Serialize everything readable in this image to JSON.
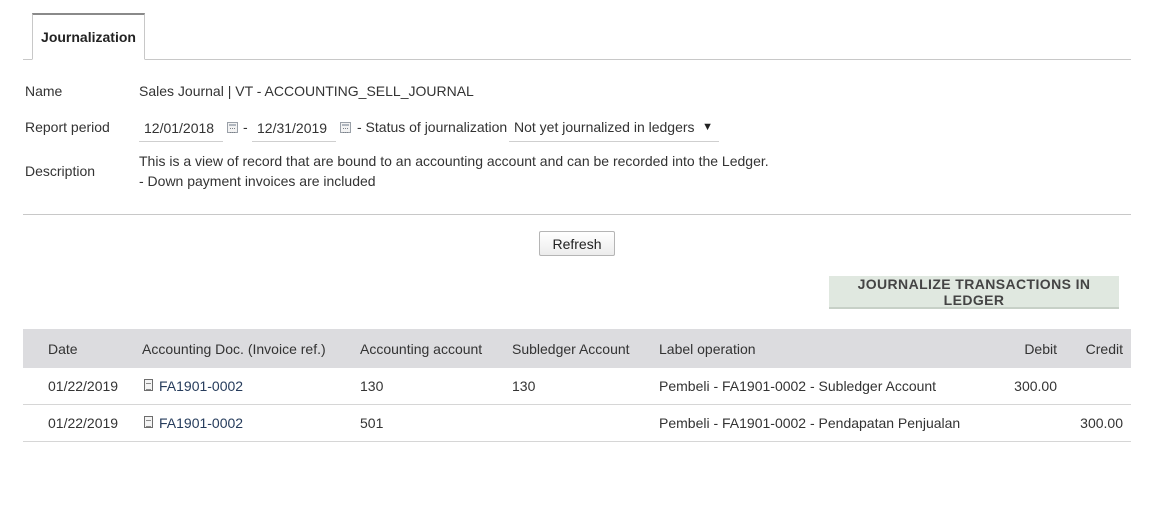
{
  "tab": {
    "label": "Journalization"
  },
  "form": {
    "name_label": "Name",
    "name_value": "Sales Journal | VT - ACCOUNTING_SELL_JOURNAL",
    "period_label": "Report period",
    "date_start": "12/01/2018",
    "date_end": "12/31/2019",
    "dash": "-",
    "status_label": "- Status of journalization",
    "status_value": "Not yet journalized in ledgers",
    "caret": "▼",
    "description_label": "Description",
    "description_line1": "This is a view of record that are bound to an accounting account and can be recorded into the Ledger.",
    "description_line2": "- Down payment invoices are included"
  },
  "buttons": {
    "refresh": "Refresh",
    "journalize": "JOURNALIZE TRANSACTIONS IN LEDGER"
  },
  "table": {
    "headers": {
      "date": "Date",
      "doc": "Accounting Doc. (Invoice ref.)",
      "account": "Accounting account",
      "subledger": "Subledger Account",
      "label": "Label operation",
      "debit": "Debit",
      "credit": "Credit"
    },
    "rows": [
      {
        "date": "01/22/2019",
        "doc": "FA1901-0002",
        "account": "130",
        "subledger": "130",
        "label": "Pembeli - FA1901-0002 - Subledger Account",
        "debit": "300.00",
        "credit": ""
      },
      {
        "date": "01/22/2019",
        "doc": "FA1901-0002",
        "account": "501",
        "subledger": "",
        "label": "Pembeli - FA1901-0002 - Pendapatan Penjualan",
        "debit": "",
        "credit": "300.00"
      }
    ]
  },
  "icons": {
    "calendar": "calendar-icon",
    "document": "document-icon"
  },
  "colors": {
    "header_bg": "#dcdcdf",
    "journalize_bg": "#e0e8e0",
    "link": "#263c5c"
  }
}
